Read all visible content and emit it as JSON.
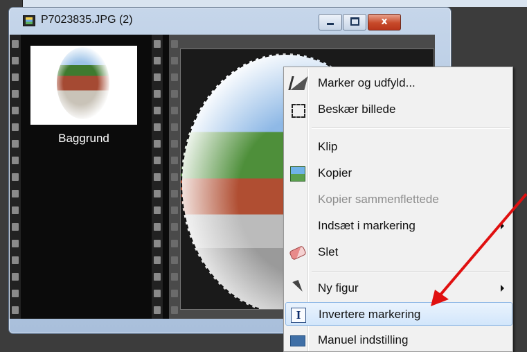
{
  "window": {
    "title": "P7023835.JPG (2)",
    "buttons": {
      "minimize": "minimize",
      "maximize": "maximize",
      "close": "x"
    }
  },
  "layers": {
    "items": [
      {
        "name": "Baggrund"
      }
    ]
  },
  "context_menu": {
    "items": [
      {
        "label": "Marker og udfyld...",
        "icon": "fill-bucket-icon",
        "enabled": true
      },
      {
        "label": "Beskær billede",
        "icon": "crop-icon",
        "enabled": true
      },
      {
        "label": "Klip",
        "icon": "",
        "enabled": true
      },
      {
        "label": "Kopier",
        "icon": "copy-image-icon",
        "enabled": true
      },
      {
        "label": "Kopier sammenflettede",
        "icon": "",
        "enabled": false
      },
      {
        "label": "Indsæt i markering",
        "icon": "",
        "enabled": true,
        "submenu": true
      },
      {
        "label": "Slet",
        "icon": "eraser-icon",
        "enabled": true
      },
      {
        "label": "Ny figur",
        "icon": "pointer-icon",
        "enabled": true,
        "submenu": true
      },
      {
        "label": "Invertere markering",
        "icon": "invert-selection-icon",
        "enabled": true,
        "highlighted": true
      },
      {
        "label": "Manuel indstilling",
        "icon": "manual-settings-icon",
        "enabled": true
      }
    ]
  },
  "colors": {
    "highlight": "#d2e6fb",
    "annotation_arrow": "#e01010",
    "disabled_text": "#8d8d8d"
  }
}
